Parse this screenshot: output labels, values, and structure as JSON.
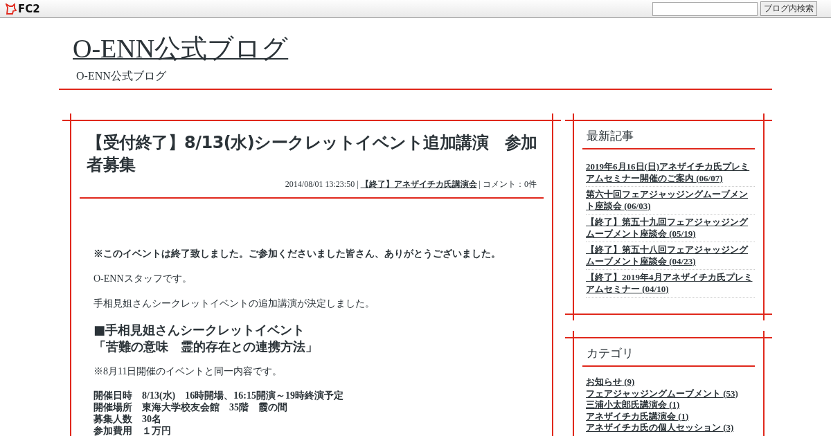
{
  "top_bar": {
    "logo": "FC2",
    "search": {
      "button": "ブログ内検索"
    }
  },
  "header": {
    "title": "O-ENN公式ブログ",
    "subtitle": "O-ENN公式ブログ"
  },
  "article": {
    "title": "【受付終了】8/13(水)シークレットイベント追加講演　参加者募集",
    "date": "2014/08/01 13:23:50 |",
    "category": "【終了】アネザイチカ氏講演会",
    "comments": "| コメント：0件",
    "body": [
      {
        "kind": "bold",
        "text": "※このイベントは終了致しました。ご参加くださいました皆さん、ありがとうございました。"
      },
      {
        "kind": "plain",
        "text": "O-ENNスタッフです。"
      },
      {
        "kind": "plain",
        "text": "手相見姐さんシークレットイベントの追加講演が決定しました。"
      },
      {
        "kind": "heading",
        "lines": [
          "■手相見姐さんシークレットイベント",
          "「苦難の意味　霊的存在との連携方法」"
        ]
      },
      {
        "kind": "plain",
        "text": "※8月11日開催のイベントと同一内容です。"
      },
      {
        "kind": "details",
        "lines": [
          "開催日時　8/13(水)　16時開場、16:15開演～19時終演予定",
          "開催場所　東海大学校友会館　35階　霞の間",
          "募集人数　30名",
          "参加費用　１万円"
        ]
      }
    ]
  },
  "sidebar": [
    {
      "title": "最新記事",
      "kind": "recent",
      "items": [
        {
          "label": "2019年6月16日(日)アネザイチカ氏プレミアムセミナー開催のご案内",
          "count": "(06/07)"
        },
        {
          "label": "第六十回フェアジャッジングムーブメント座談会",
          "count": "(06/03)"
        },
        {
          "label": "【終了】第五十九回フェアジャッジングムーブメント座談会",
          "count": "(05/19)"
        },
        {
          "label": "【終了】第五十八回フェアジャッジングムーブメント座談会",
          "count": "(04/23)"
        },
        {
          "label": "【終了】2019年4月アネザイチカ氏プレミアムセミナー",
          "count": "(04/10)"
        }
      ]
    },
    {
      "title": "カテゴリ",
      "kind": "categories",
      "items": [
        {
          "label": "お知らせ",
          "count": "(9)"
        },
        {
          "label": "フェアジャッジングムーブメント",
          "count": "(53)"
        },
        {
          "label": "三浦小太郎氏講演会",
          "count": "(1)"
        },
        {
          "label": "アネザイチカ氏講演会",
          "count": "(1)"
        },
        {
          "label": "アネザイチカ氏の個人セッション",
          "count": "(3)"
        }
      ]
    }
  ]
}
